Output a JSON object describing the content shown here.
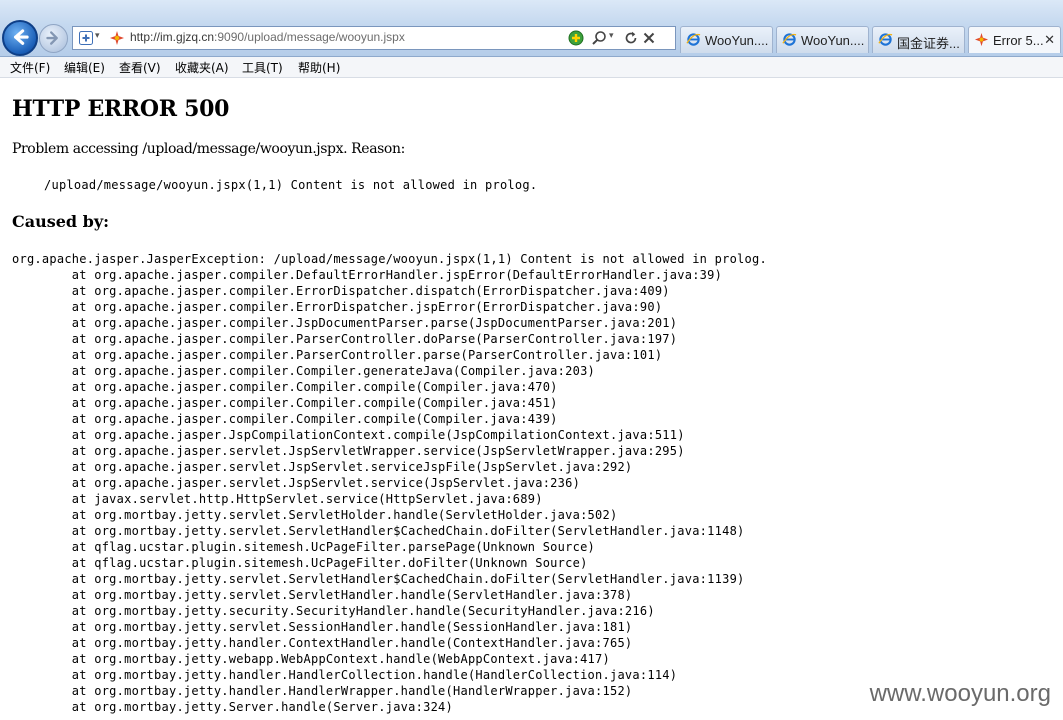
{
  "addressbar": {
    "url_host": "http://im.gjzq.cn",
    "url_path": ":9090/upload/message/wooyun.jspx"
  },
  "tabs": [
    {
      "label": "WooYun....",
      "active": false
    },
    {
      "label": "WooYun....",
      "active": false
    },
    {
      "label": "国金证券...",
      "active": false
    },
    {
      "label": "Error 5...",
      "active": true
    }
  ],
  "menu": [
    "文件(F)",
    "编辑(E)",
    "查看(V)",
    "收藏夹(A)",
    "工具(T)",
    "帮助(H)"
  ],
  "page": {
    "title": "HTTP ERROR 500",
    "reason": "Problem accessing /upload/message/wooyun.jspx. Reason:",
    "message": "/upload/message/wooyun.jspx(1,1) Content is not allowed in prolog.",
    "caused_by": "Caused by:",
    "exception": "org.apache.jasper.JasperException: /upload/message/wooyun.jspx(1,1) Content is not allowed in prolog.",
    "stack": [
      "at org.apache.jasper.compiler.DefaultErrorHandler.jspError(DefaultErrorHandler.java:39)",
      "at org.apache.jasper.compiler.ErrorDispatcher.dispatch(ErrorDispatcher.java:409)",
      "at org.apache.jasper.compiler.ErrorDispatcher.jspError(ErrorDispatcher.java:90)",
      "at org.apache.jasper.compiler.JspDocumentParser.parse(JspDocumentParser.java:201)",
      "at org.apache.jasper.compiler.ParserController.doParse(ParserController.java:197)",
      "at org.apache.jasper.compiler.ParserController.parse(ParserController.java:101)",
      "at org.apache.jasper.compiler.Compiler.generateJava(Compiler.java:203)",
      "at org.apache.jasper.compiler.Compiler.compile(Compiler.java:470)",
      "at org.apache.jasper.compiler.Compiler.compile(Compiler.java:451)",
      "at org.apache.jasper.compiler.Compiler.compile(Compiler.java:439)",
      "at org.apache.jasper.JspCompilationContext.compile(JspCompilationContext.java:511)",
      "at org.apache.jasper.servlet.JspServletWrapper.service(JspServletWrapper.java:295)",
      "at org.apache.jasper.servlet.JspServlet.serviceJspFile(JspServlet.java:292)",
      "at org.apache.jasper.servlet.JspServlet.service(JspServlet.java:236)",
      "at javax.servlet.http.HttpServlet.service(HttpServlet.java:689)",
      "at org.mortbay.jetty.servlet.ServletHolder.handle(ServletHolder.java:502)",
      "at org.mortbay.jetty.servlet.ServletHandler$CachedChain.doFilter(ServletHandler.java:1148)",
      "at qflag.ucstar.plugin.sitemesh.UcPageFilter.parsePage(Unknown Source)",
      "at qflag.ucstar.plugin.sitemesh.UcPageFilter.doFilter(Unknown Source)",
      "at org.mortbay.jetty.servlet.ServletHandler$CachedChain.doFilter(ServletHandler.java:1139)",
      "at org.mortbay.jetty.servlet.ServletHandler.handle(ServletHandler.java:378)",
      "at org.mortbay.jetty.security.SecurityHandler.handle(SecurityHandler.java:216)",
      "at org.mortbay.jetty.servlet.SessionHandler.handle(SessionHandler.java:181)",
      "at org.mortbay.jetty.handler.ContextHandler.handle(ContextHandler.java:765)",
      "at org.mortbay.jetty.webapp.WebAppContext.handle(WebAppContext.java:417)",
      "at org.mortbay.jetty.handler.HandlerCollection.handle(HandlerCollection.java:114)",
      "at org.mortbay.jetty.handler.HandlerWrapper.handle(HandlerWrapper.java:152)",
      "at org.mortbay.jetty.Server.handle(Server.java:324)"
    ]
  },
  "watermark": "www.wooyun.org"
}
